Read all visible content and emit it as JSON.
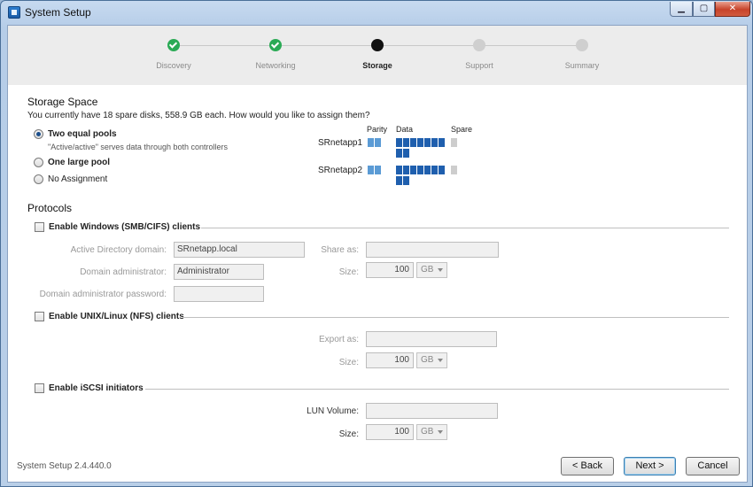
{
  "window": {
    "title": "System Setup"
  },
  "window_controls": {
    "minimize": "▁",
    "maximize": "▢",
    "close": "✕"
  },
  "wizard_steps": [
    {
      "label": "Discovery",
      "state": "done"
    },
    {
      "label": "Networking",
      "state": "done"
    },
    {
      "label": "Storage",
      "state": "current"
    },
    {
      "label": "Support",
      "state": "todo"
    },
    {
      "label": "Summary",
      "state": "todo"
    }
  ],
  "storage": {
    "title": "Storage Space",
    "description": "You currently have 18 spare disks, 558.9 GB each. How would you like to assign them?",
    "options": [
      {
        "label": "Two equal pools",
        "selected": true,
        "note": "\"Active/active\" serves data through both controllers"
      },
      {
        "label": "One large pool",
        "selected": false
      },
      {
        "label": "No Assignment",
        "selected": false
      }
    ],
    "columns": {
      "parity": "Parity",
      "data": "Data",
      "spare": "Spare"
    },
    "pools": [
      {
        "name": "SRnetapp1",
        "parity": 2,
        "data": 9,
        "spare": 1
      },
      {
        "name": "SRnetapp2",
        "parity": 2,
        "data": 9,
        "spare": 1
      }
    ],
    "colors": {
      "parity": "#5b9bd5",
      "data": "#1f5fae",
      "spare": "#cdcdcd"
    }
  },
  "protocols": {
    "title": "Protocols",
    "smb": {
      "label": "Enable Windows (SMB/CIFS) clients",
      "ad_domain_label": "Active Directory domain:",
      "ad_domain_value": "SRnetapp.local",
      "domain_admin_label": "Domain administrator:",
      "domain_admin_value": "Administrator",
      "domain_password_label": "Domain administrator password:",
      "share_as_label": "Share as:",
      "size_label": "Size:",
      "size_value": "100",
      "size_unit": "GB"
    },
    "nfs": {
      "label": "Enable UNIX/Linux (NFS) clients",
      "export_as_label": "Export as:",
      "size_label": "Size:",
      "size_value": "100",
      "size_unit": "GB"
    },
    "iscsi": {
      "label": "Enable iSCSI initiators",
      "lun_volume_label": "LUN Volume:",
      "size_label": "Size:",
      "size_value": "100",
      "size_unit": "GB"
    }
  },
  "footer": {
    "version": "System Setup 2.4.440.0",
    "back": "< Back",
    "next": "Next >",
    "cancel": "Cancel"
  }
}
